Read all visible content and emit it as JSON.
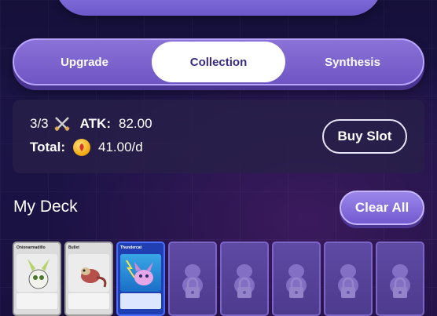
{
  "tabs": [
    {
      "label": "Upgrade",
      "active": false
    },
    {
      "label": "Collection",
      "active": true
    },
    {
      "label": "Synthesis",
      "active": false
    }
  ],
  "stats": {
    "slots": "3/3",
    "atk_label": "ATK:",
    "atk_value": "82.00",
    "total_label": "Total:",
    "total_value": "41.00/d"
  },
  "buy_slot_label": "Buy Slot",
  "deck": {
    "title": "My Deck",
    "clear_label": "Clear All",
    "cards": [
      {
        "name": "Onionarmadillo",
        "state": "filled",
        "theme": "silver"
      },
      {
        "name": "Bullet",
        "state": "filled",
        "theme": "silver"
      },
      {
        "name": "Thundercat",
        "state": "filled",
        "theme": "blue"
      },
      {
        "name": "",
        "state": "locked"
      },
      {
        "name": "",
        "state": "locked"
      },
      {
        "name": "",
        "state": "locked"
      },
      {
        "name": "",
        "state": "locked"
      },
      {
        "name": "",
        "state": "locked"
      }
    ]
  },
  "icons": {
    "slots": "swords-icon",
    "coin": "coin-icon",
    "lock": "lock-icon"
  },
  "colors": {
    "tab_bar": "#7a62cf",
    "active_tab": "#ffffff",
    "panel": "#282048",
    "locked_card": "#5e4aa3"
  }
}
